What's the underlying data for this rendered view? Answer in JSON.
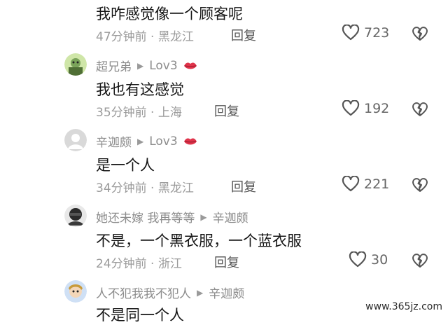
{
  "comments": [
    {
      "username": "",
      "level": "",
      "text": "我咋感觉像一个顾客呢",
      "time_location": "47分钟前 · 黑龙江",
      "reply_label": "回复",
      "likes": "723"
    },
    {
      "username": "超兄弟",
      "level": "Lov3",
      "text": "我也有这感觉",
      "time_location": "35分钟前 · 上海",
      "reply_label": "回复",
      "likes": "192"
    },
    {
      "username": "辛迦颇",
      "level": "Lov3",
      "text": "是一个人",
      "time_location": "34分钟前 · 黑龙江",
      "reply_label": "回复",
      "likes": "221"
    },
    {
      "username": "她还未嫁 我再等等",
      "reply_to": "辛迦颇",
      "text": "不是，一个黑衣服，一个蓝衣服",
      "time_location": "24分钟前 · 浙江",
      "reply_label": "回复",
      "likes": "30"
    },
    {
      "username": "人不犯我我不犯人",
      "reply_to": "辛迦颇",
      "text": "不是同一个人"
    }
  ],
  "icons": {
    "like": "heart-outline-icon",
    "dislike": "broken-heart-icon",
    "badge": "red-lips-icon",
    "reply_arrow": "triangle-right-icon"
  },
  "colors": {
    "badge": "#e0334a",
    "meta": "#9a9a9a"
  },
  "watermark": "www.365jz.com"
}
